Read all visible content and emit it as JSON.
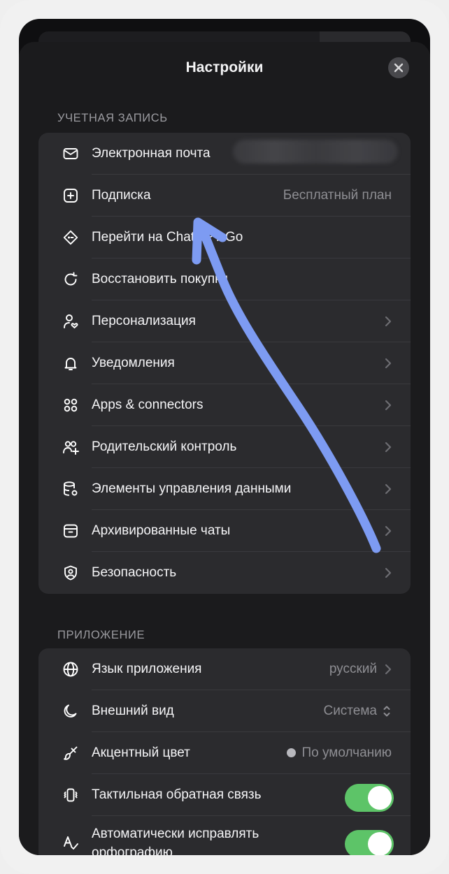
{
  "header": {
    "title": "Настройки"
  },
  "sections": {
    "account": {
      "label": "УЧЕТНАЯ ЗАПИСЬ",
      "rows": [
        {
          "label": "Электронная почта",
          "icon": "envelope-icon"
        },
        {
          "label": "Подписка",
          "value": "Бесплатный план",
          "icon": "plus-square-icon"
        },
        {
          "label": "Перейти на ChatGPT Go",
          "icon": "tag-icon"
        },
        {
          "label": "Восстановить покупки",
          "icon": "refresh-icon"
        },
        {
          "label": "Персонализация",
          "icon": "person-heart-icon"
        },
        {
          "label": "Уведомления",
          "icon": "bell-icon"
        },
        {
          "label": "Apps & connectors",
          "icon": "apps-grid-icon"
        },
        {
          "label": "Родительский контроль",
          "icon": "users-plus-icon"
        },
        {
          "label": "Элементы управления данными",
          "icon": "database-gear-icon"
        },
        {
          "label": "Архивированные чаты",
          "icon": "archive-icon"
        },
        {
          "label": "Безопасность",
          "icon": "shield-user-icon"
        }
      ]
    },
    "app": {
      "label": "ПРИЛОЖЕНИЕ",
      "rows": [
        {
          "label": "Язык приложения",
          "value": "русский",
          "icon": "globe-icon"
        },
        {
          "label": "Внешний вид",
          "value": "Система",
          "icon": "moon-icon"
        },
        {
          "label": "Акцентный цвет",
          "value": "По умолчанию",
          "icon": "paint-brush-icon"
        },
        {
          "label": "Тактильная обратная связь",
          "toggle": true,
          "icon": "vibrate-icon"
        },
        {
          "label": "Автоматически исправлять орфографию",
          "toggle": true,
          "icon": "spellcheck-icon"
        }
      ]
    }
  },
  "colors": {
    "toggle_on": "#5dc468",
    "annotation_arrow": "#7d9bf2",
    "accent_dot": "#b8b8bd"
  }
}
